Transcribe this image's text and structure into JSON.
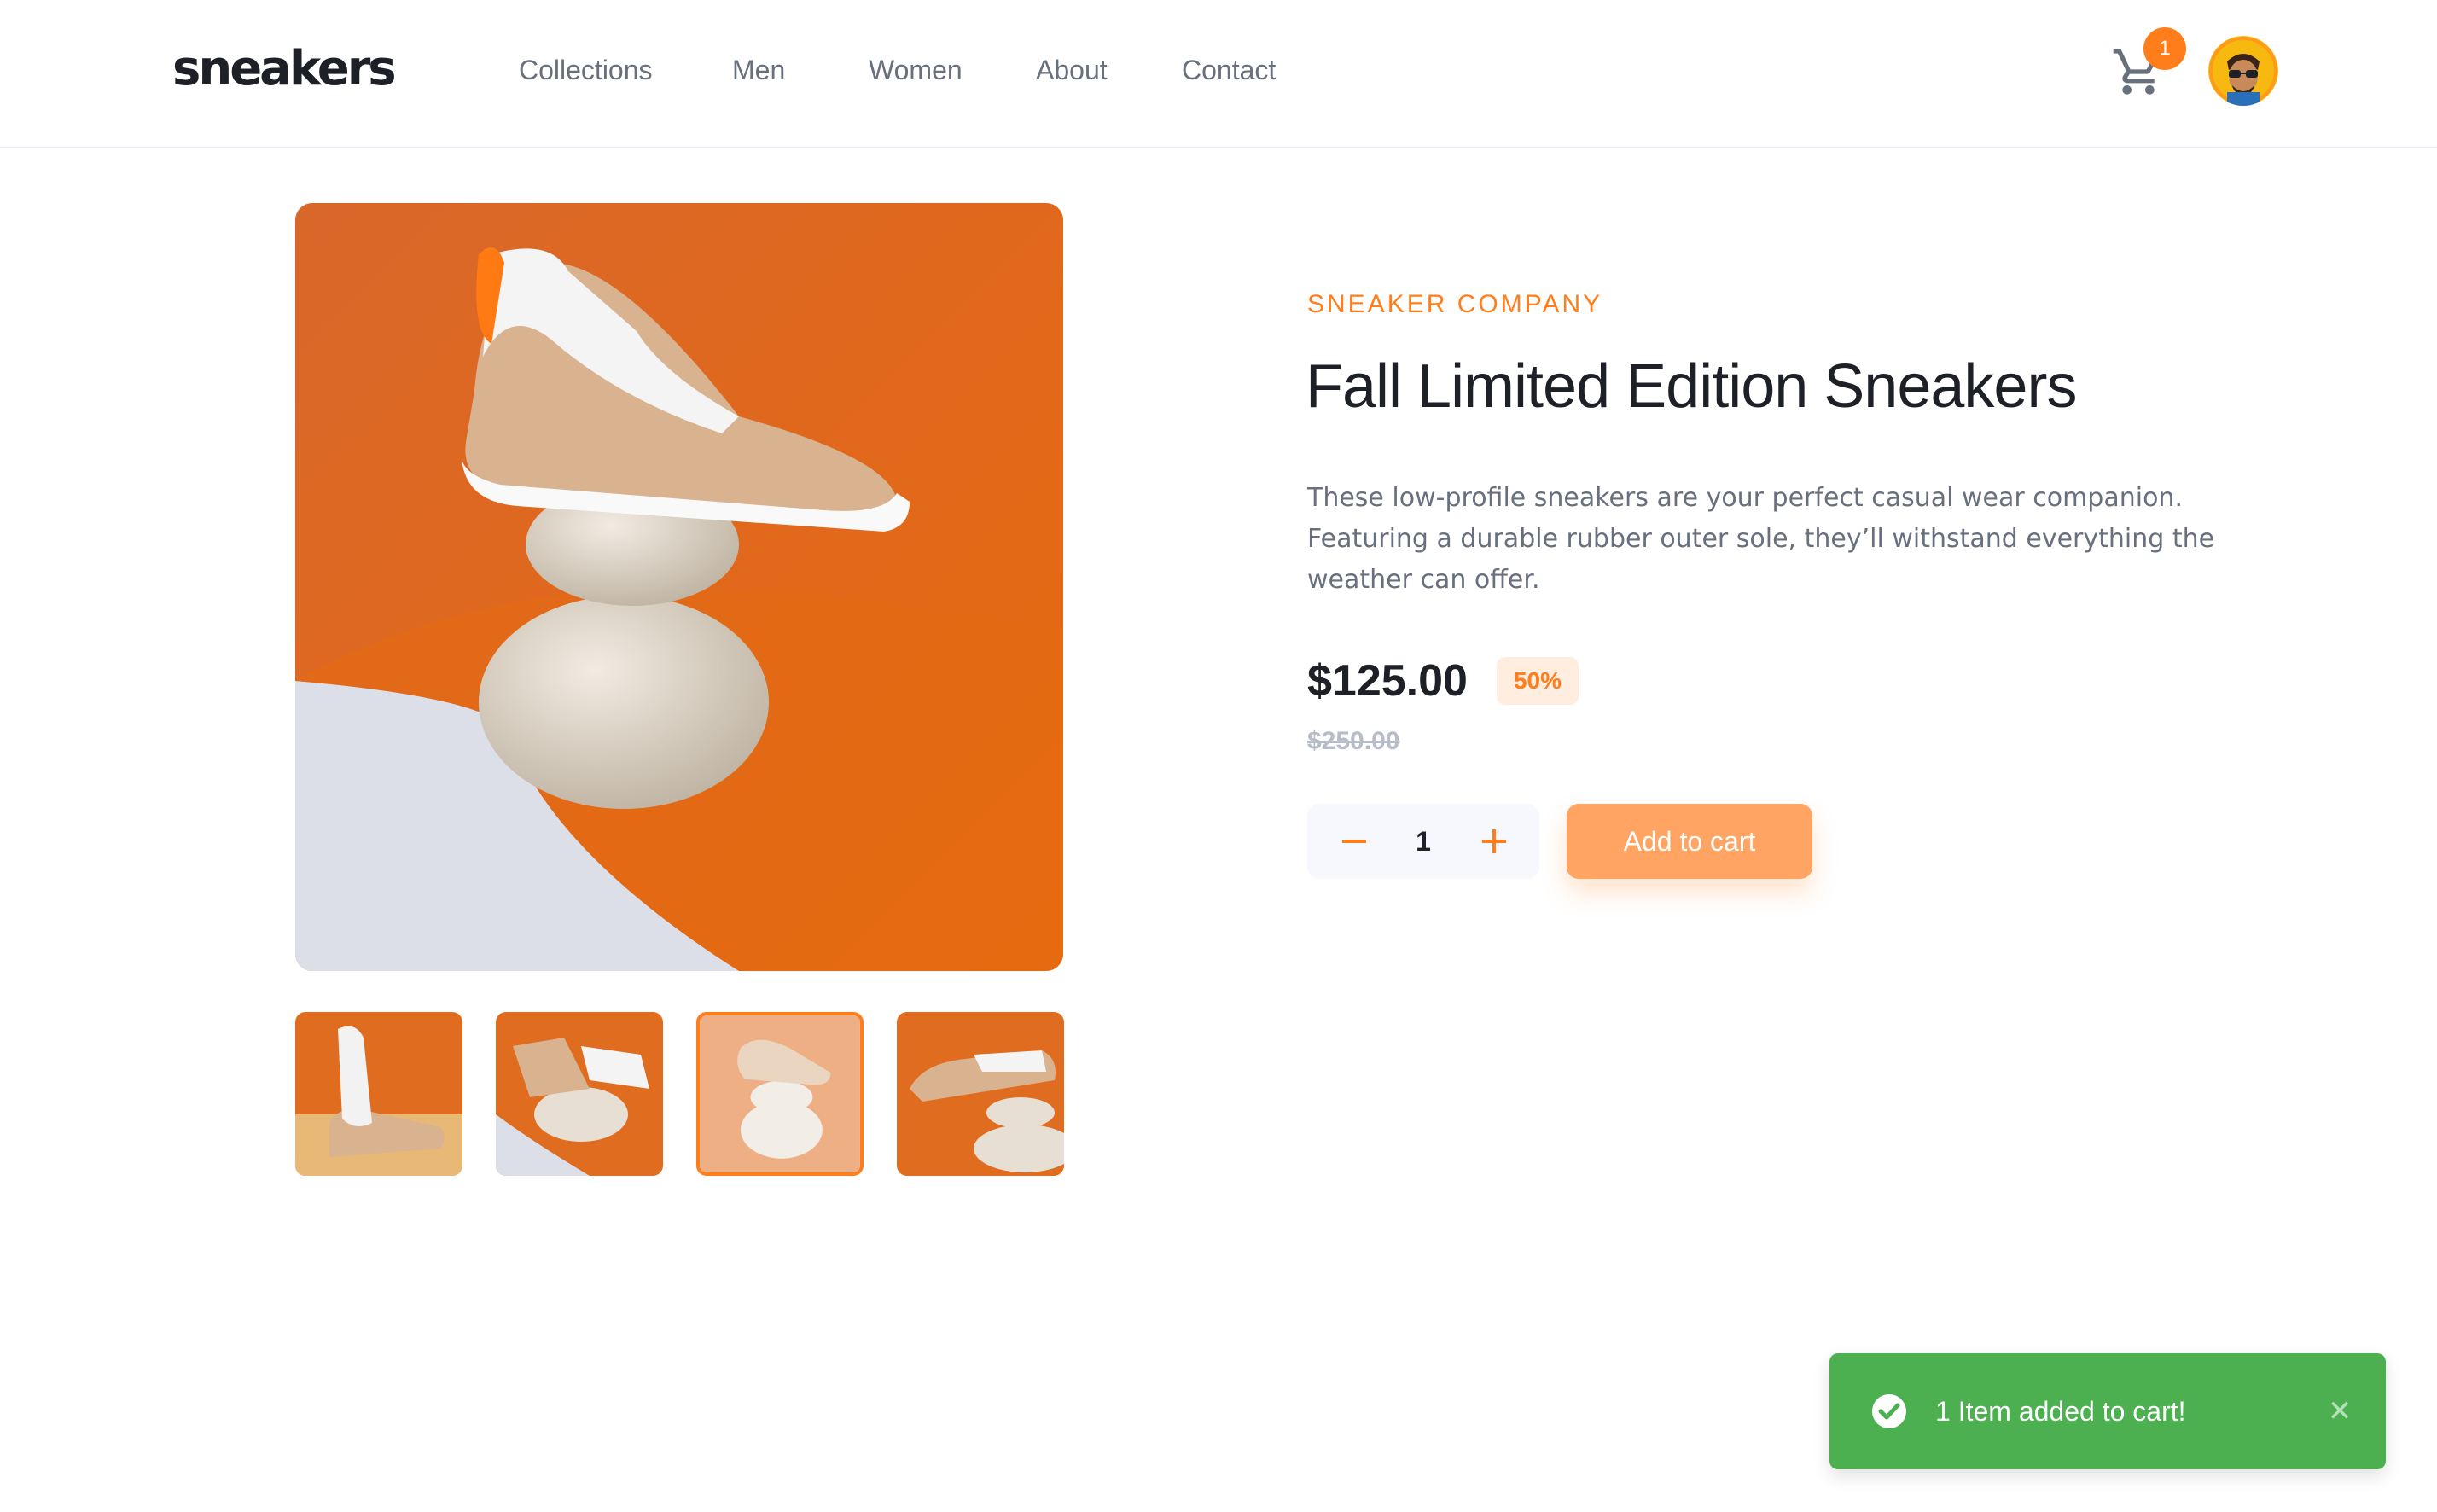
{
  "header": {
    "logo": "sneakers",
    "nav": [
      "Collections",
      "Men",
      "Women",
      "About",
      "Contact"
    ],
    "cart_count": "1"
  },
  "gallery": {
    "selected_thumbnail": 3,
    "thumbnail_count": 4
  },
  "product": {
    "company": "SNEAKER COMPANY",
    "title": "Fall Limited Edition Sneakers",
    "description": "These low-profile sneakers are your perfect casual wear companion. Featuring a durable rubber outer sole, they’ll withstand everything the weather can offer.",
    "price": "$125.00",
    "discount": "50%",
    "original_price": "$250.00",
    "quantity": "1",
    "add_to_cart_label": "Add to cart"
  },
  "toast": {
    "message": "1 Item added to cart!",
    "close_glyph": "✕"
  },
  "colors": {
    "accent": "#ff7e1b",
    "accent_light": "#ffa462",
    "toast_green": "#4caf50",
    "text_dark": "#1d2026",
    "text_muted": "#68707d"
  }
}
